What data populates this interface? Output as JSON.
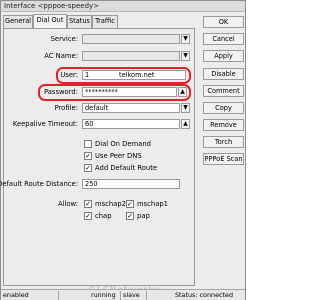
{
  "window": {
    "title": "Interface <pppoe-speedy>"
  },
  "tabs": [
    {
      "label": "General",
      "active": false
    },
    {
      "label": "Dial Out",
      "active": true
    },
    {
      "label": "Status",
      "active": false
    },
    {
      "label": "Traffic",
      "active": false
    }
  ],
  "form": {
    "service": {
      "label": "Service:",
      "value": ""
    },
    "ac_name": {
      "label": "AC Name:",
      "value": ""
    },
    "user": {
      "label": "User:",
      "value": "1",
      "value_suffix": "telkom.net"
    },
    "password": {
      "label": "Password:",
      "value": "**********"
    },
    "profile": {
      "label": "Profile:",
      "value": "default"
    },
    "keepalive": {
      "label": "Keepalive Timeout:",
      "value": "60"
    },
    "dial_on_demand": {
      "label": "Dial On Demand",
      "checked": false
    },
    "use_peer_dns": {
      "label": "Use Peer DNS",
      "checked": true
    },
    "add_default_route": {
      "label": "Add Default Route",
      "checked": true
    },
    "default_route_distance": {
      "label": "Default Route Distance:",
      "value": "250"
    },
    "allow": {
      "label": "Allow:",
      "options": [
        {
          "label": "mschap2",
          "checked": true
        },
        {
          "label": "mschap1",
          "checked": true
        },
        {
          "label": "chap",
          "checked": true
        },
        {
          "label": "pap",
          "checked": true
        }
      ]
    }
  },
  "buttons": [
    "OK",
    "Cancel",
    "Apply",
    "Disable",
    "Comment",
    "Copy",
    "Remove",
    "Torch",
    "PPPoE Scan"
  ],
  "status_bar": {
    "state": "enabled",
    "run": "running",
    "slave": "slave",
    "status": "Status: connected"
  },
  "watermark": "GLCNetworks",
  "colors": {
    "highlight": "#e0232b",
    "window_bg": "#ececec"
  }
}
